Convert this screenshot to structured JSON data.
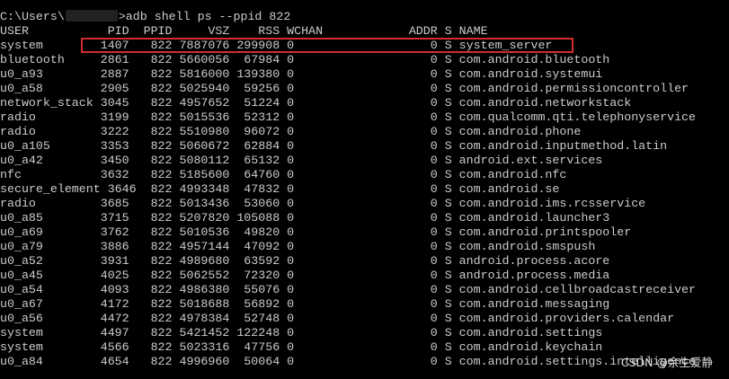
{
  "terminal": {
    "prompt_prefix": "C:\\Users\\",
    "prompt_suffix": ">adb shell ps --ppid 822",
    "header": "USER           PID  PPID     VSZ    RSS WCHAN            ADDR S NAME",
    "rows": [
      "system        1407   822 7887076 299908 0                   0 S system_server",
      "bluetooth     2861   822 5660056  67984 0                   0 S com.android.bluetooth",
      "u0_a93        2887   822 5816000 139380 0                   0 S com.android.systemui",
      "u0_a58        2905   822 5025940  59256 0                   0 S com.android.permissioncontroller",
      "network_stack 3045   822 4957652  51224 0                   0 S com.android.networkstack",
      "radio         3199   822 5015536  52312 0                   0 S com.qualcomm.qti.telephonyservice",
      "radio         3222   822 5510980  96072 0                   0 S com.android.phone",
      "u0_a105       3353   822 5060672  62884 0                   0 S com.android.inputmethod.latin",
      "u0_a42        3450   822 5080112  65132 0                   0 S android.ext.services",
      "nfc           3632   822 5185600  64760 0                   0 S com.android.nfc",
      "secure_element 3646  822 4993348  47832 0                   0 S com.android.se",
      "radio         3685   822 5013436  53060 0                   0 S com.android.ims.rcsservice",
      "u0_a85        3715   822 5207820 105088 0                   0 S com.android.launcher3",
      "u0_a69        3762   822 5010536  49820 0                   0 S com.android.printspooler",
      "u0_a79        3886   822 4957144  47092 0                   0 S com.android.smspush",
      "u0_a52        3931   822 4989680  63592 0                   0 S android.process.acore",
      "u0_a45        4025   822 5062552  72320 0                   0 S android.process.media",
      "u0_a54        4093   822 4986380  55076 0                   0 S com.android.cellbroadcastreceiver",
      "u0_a67        4172   822 5018688  56892 0                   0 S com.android.messaging",
      "u0_a56        4472   822 4978384  52748 0                   0 S com.android.providers.calendar",
      "system        4497   822 5421452 122248 0                   0 S com.android.settings",
      "system        4566   822 5023316  47756 0                   0 S com.android.keychain",
      "u0_a84        4654   822 4996960  50064 0                   0 S com.android.settings.intelligence"
    ]
  },
  "watermark": {
    "text": "CSDN @余生爱静"
  },
  "colors": {
    "background": "#000000",
    "text": "#cccccc",
    "highlight": "#d32d2d"
  }
}
